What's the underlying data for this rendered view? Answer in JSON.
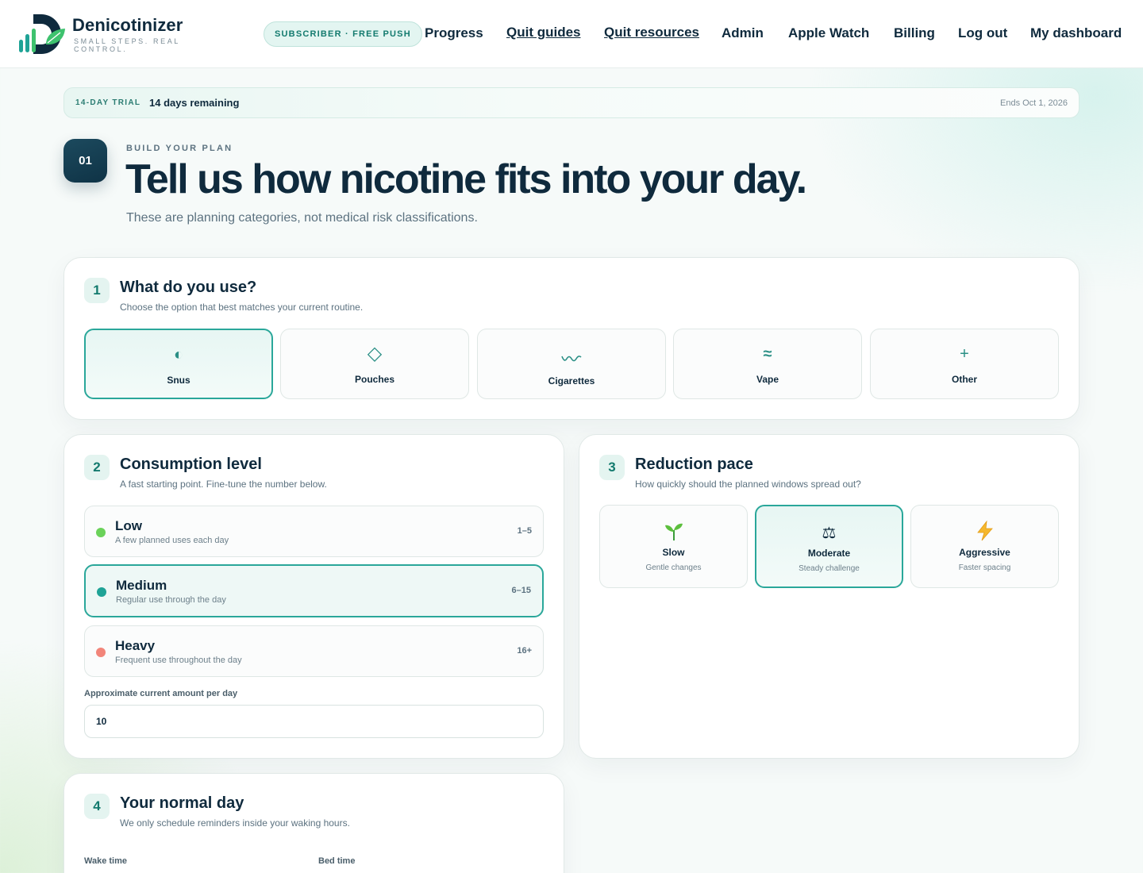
{
  "brand": {
    "name": "Denicotinizer",
    "tagline": "SMALL STEPS. REAL CONTROL.",
    "colors": {
      "primary": "#0f2a3d",
      "accent": "#2aa79a",
      "leaf": "#3ec26e"
    }
  },
  "header": {
    "subscription_pill": "SUBSCRIBER · FREE PUSH",
    "nav": [
      {
        "label": "Progress",
        "icon": ""
      },
      {
        "label": "Quit guides"
      },
      {
        "label": "Quit resources"
      },
      {
        "label": "Admin"
      },
      {
        "label": "Apple Watch"
      },
      {
        "label": "Billing"
      },
      {
        "label": "Log out"
      },
      {
        "label": "My dashboard"
      }
    ]
  },
  "trial": {
    "tag": "14-DAY TRIAL",
    "remaining": "14 days remaining",
    "ends": "Ends Oct 1, 2026"
  },
  "hero": {
    "step": "01",
    "eyebrow": "BUILD YOUR PLAN",
    "title": "Tell us how nicotine fits into your day.",
    "subtitle": "These are planning categories, not medical risk classifications."
  },
  "section1": {
    "number": "1",
    "title": "What do you use?",
    "subtitle": "Choose the option that best matches your current routine.",
    "options": [
      {
        "label": "Snus",
        "icon": "half-circle-icon",
        "glyph": "◐",
        "selected": true
      },
      {
        "label": "Pouches",
        "icon": "diamond-icon",
        "glyph": "◇",
        "selected": false
      },
      {
        "label": "Cigarettes",
        "icon": "smoke-wave-icon",
        "glyph": "〰",
        "selected": false
      },
      {
        "label": "Vape",
        "icon": "vapor-icon",
        "glyph": "≈",
        "selected": false
      },
      {
        "label": "Other",
        "icon": "plus-icon",
        "glyph": "+",
        "selected": false
      }
    ]
  },
  "section2": {
    "number": "2",
    "title": "Consumption level",
    "subtitle": "A fast starting point. Fine-tune the number below.",
    "levels": [
      {
        "name": "Low",
        "desc": "A few planned uses each day",
        "range": "1–5",
        "color": "#6bd25a",
        "selected": false
      },
      {
        "name": "Medium",
        "desc": "Regular use through the day",
        "range": "6–15",
        "color": "#1fa396",
        "selected": true
      },
      {
        "name": "Heavy",
        "desc": "Frequent use throughout the day",
        "range": "16+",
        "color": "#f2857a",
        "selected": false
      }
    ],
    "amount_label": "Approximate current amount per day",
    "amount_value": "10"
  },
  "section3": {
    "number": "3",
    "title": "Reduction pace",
    "subtitle": "How quickly should the planned windows spread out?",
    "paces": [
      {
        "name": "Slow",
        "desc": "Gentle changes",
        "icon": "seedling-icon",
        "glyph": "🌱",
        "selected": false
      },
      {
        "name": "Moderate",
        "desc": "Steady challenge",
        "icon": "scales-icon",
        "glyph": "⚖",
        "selected": true
      },
      {
        "name": "Aggressive",
        "desc": "Faster spacing",
        "icon": "lightning-icon",
        "glyph": "⚡",
        "selected": false
      }
    ]
  },
  "section4": {
    "number": "4",
    "title": "Your normal day",
    "subtitle": "We only schedule reminders inside your waking hours.",
    "wake_label": "Wake time",
    "bed_label": "Bed time"
  }
}
